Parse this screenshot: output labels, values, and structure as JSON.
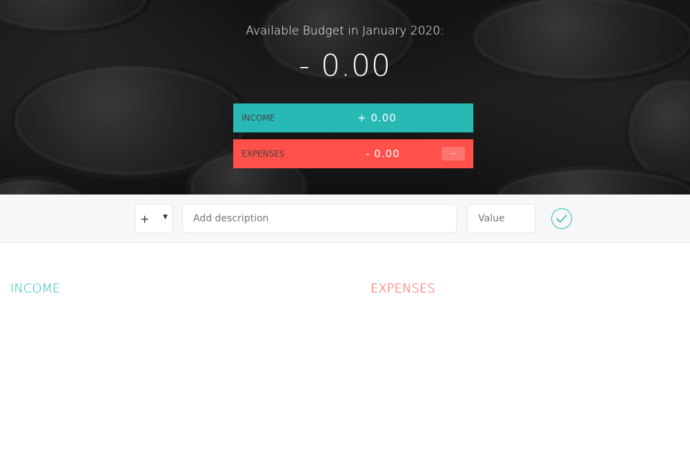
{
  "budget": {
    "title": "Available Budget in January 2020:",
    "value": "- 0.00"
  },
  "summary": {
    "income": {
      "label": "INCOME",
      "value": "+ 0.00"
    },
    "expenses": {
      "label": "EXPENSES",
      "value": "- 0.00",
      "percentage": "---"
    }
  },
  "add_form": {
    "type_selected": "+",
    "description_placeholder": "Add description",
    "value_placeholder": "Value",
    "submit_icon": "check-circle-icon"
  },
  "lists": {
    "income_title": "INCOME",
    "expenses_title": "EXPENSES"
  },
  "colors": {
    "income": "#28b9b5",
    "expenses": "#ff5049"
  }
}
